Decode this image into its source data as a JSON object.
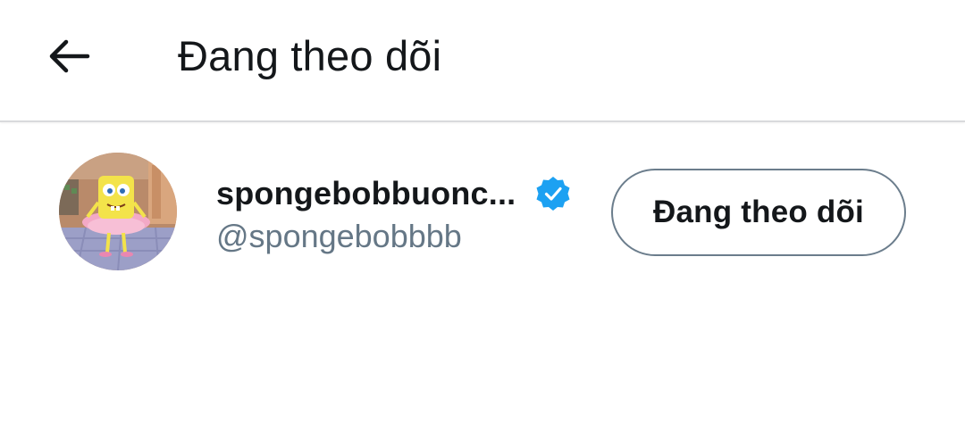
{
  "header": {
    "back_icon": "arrow-left-icon",
    "title": "Đang theo dõi"
  },
  "following_list": [
    {
      "display_name": "spongebobbuonc...",
      "handle": "@spongebobbbb",
      "verified_icon": "verified-badge-icon",
      "follow_button_label": "Đang theo dõi"
    }
  ],
  "colors": {
    "text_primary": "#14171a",
    "text_secondary": "#657786",
    "verified_blue": "#1da1f2",
    "button_border": "#6b7d8c",
    "divider": "#d9dadc"
  }
}
